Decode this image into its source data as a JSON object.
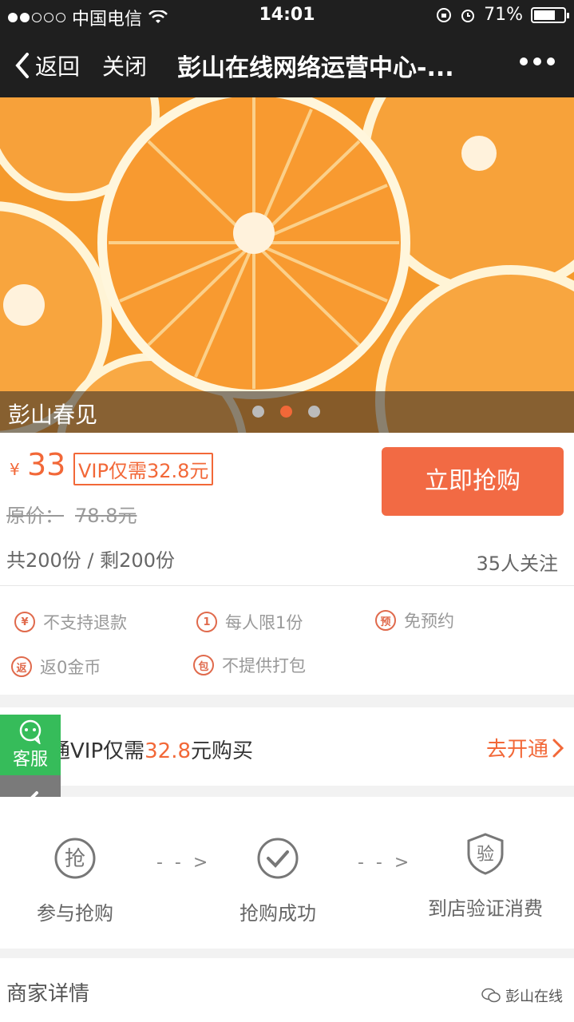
{
  "status_bar": {
    "carrier": "中国电信",
    "time": "14:01",
    "battery_percent": "71%",
    "battery_level": 0.71
  },
  "nav": {
    "back_label": "返回",
    "close_label": "关闭",
    "title": "彭山在线网络运营中心-..."
  },
  "banner": {
    "caption": "彭山春见",
    "slide_count": 3,
    "active_slide": 2
  },
  "price": {
    "currency": "¥",
    "current": "33",
    "vip_tag": "VIP仅需32.8元",
    "original_label": "原价：",
    "original_value": "78.8元",
    "buy_button": "立即抢购",
    "stock": "共200份 / 剩200份",
    "followers": "35人关注"
  },
  "features": [
    {
      "icon": "¥",
      "icon_name": "no-refund-icon",
      "label": "不支持退款"
    },
    {
      "icon": "1",
      "icon_name": "limit-one-icon",
      "label": "每人限1份"
    },
    {
      "icon": "预",
      "icon_name": "no-reservation-icon",
      "label": "免预约"
    },
    {
      "icon": "返",
      "icon_name": "coin-return-icon",
      "label": "返0金币"
    },
    {
      "icon": "包",
      "icon_name": "no-packing-icon",
      "label": "不提供打包"
    }
  ],
  "vip_bar": {
    "prefix": "开通VIP仅需",
    "highlight": "32.8",
    "suffix": "元购买",
    "action": "去开通"
  },
  "floating": {
    "service_label": "客服"
  },
  "steps": [
    {
      "icon": "抢",
      "label": "参与抢购"
    },
    {
      "icon": "✓",
      "label": "抢购成功"
    },
    {
      "icon": "验",
      "label": "到店验证消费"
    }
  ],
  "step_arrow": "- - >",
  "merchant": {
    "title": "商家详情",
    "watermark": "彭山在线"
  },
  "colors": {
    "accent": "#f26838",
    "service_green": "#36bc5a",
    "nav_bg": "#1f1f1f"
  }
}
